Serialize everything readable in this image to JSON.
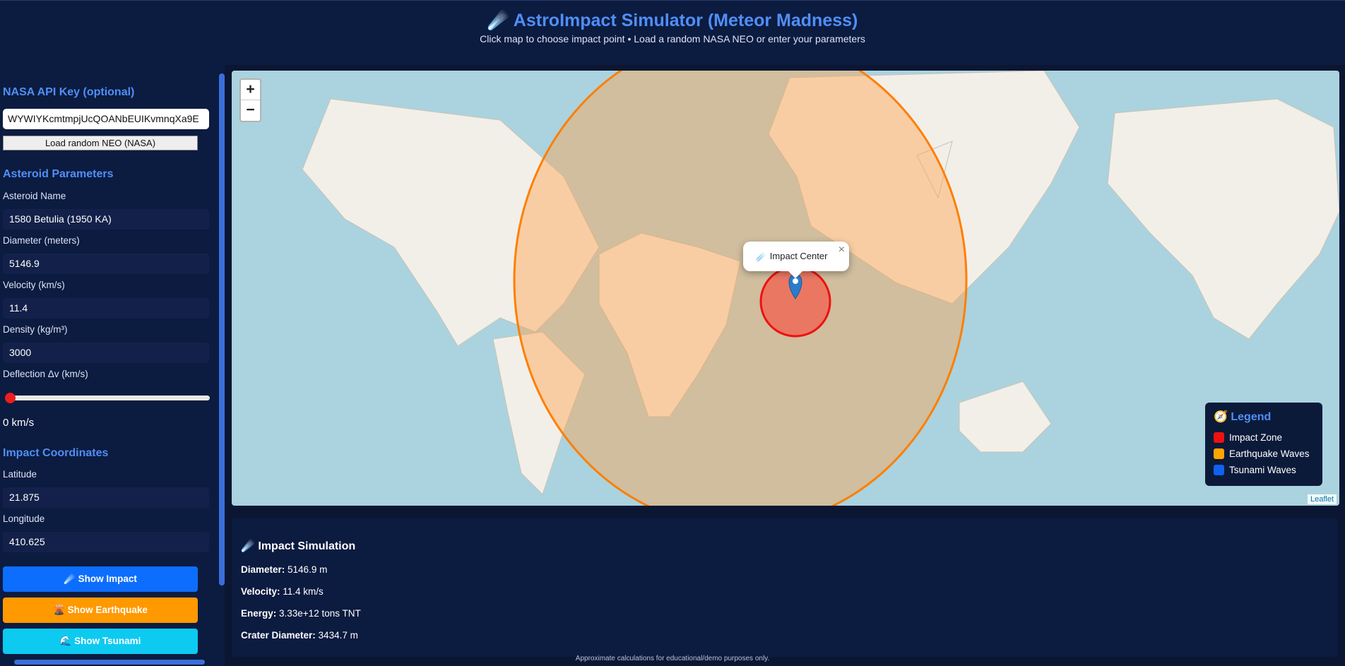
{
  "header": {
    "icon": "☄️",
    "title": "AstroImpact Simulator (Meteor Madness)",
    "subtitle": "Click map to choose impact point • Load a random NASA NEO or enter your parameters"
  },
  "sidebar": {
    "api_heading": "NASA API Key (optional)",
    "api_value": "WYWIYKcmtmpjUcQOANbEUIKvmnqXa9E",
    "load_neo_label": "Load random NEO (NASA)",
    "params_heading": "Asteroid Parameters",
    "name_label": "Asteroid Name",
    "name_value": "1580 Betulia (1950 KA)",
    "diameter_label": "Diameter (meters)",
    "diameter_value": "5146.9",
    "velocity_label": "Velocity (km/s)",
    "velocity_value": "11.4",
    "density_label": "Density (kg/m³)",
    "density_value": "3000",
    "deflection_label": "Deflection Δv (km/s)",
    "deflection_value": 0,
    "deflection_text": "0 km/s",
    "coords_heading": "Impact Coordinates",
    "lat_label": "Latitude",
    "lat_value": "21.875",
    "lon_label": "Longitude",
    "lon_value": "410.625",
    "btn_impact": "☄️ Show Impact",
    "btn_earthquake": "🌋 Show Earthquake",
    "btn_tsunami": "🌊 Show Tsunami"
  },
  "map": {
    "zoom_in": "+",
    "zoom_out": "−",
    "popup_text": "☄️ Impact Center",
    "popup_close": "×",
    "attribution": "Leaflet",
    "legend": {
      "title": "🧭 Legend",
      "items": [
        {
          "label": "Impact Zone",
          "color": "#ee1111"
        },
        {
          "label": "Earthquake Waves",
          "color": "#ffa500"
        },
        {
          "label": "Tsunami Waves",
          "color": "#1160ee"
        }
      ]
    }
  },
  "results": {
    "title": "☄️ Impact Simulation",
    "diameter_label": "Diameter:",
    "diameter_value": " 5146.9 m",
    "velocity_label": "Velocity:",
    "velocity_value": " 11.4 km/s",
    "energy_label": "Energy:",
    "energy_value": " 3.33e+12 tons TNT",
    "crater_label": "Crater Diameter:",
    "crater_value": " 3434.7 m"
  },
  "footer": "Approximate calculations for educational/demo purposes only.",
  "colors": {
    "accent": "#4f8ff7",
    "impact_btn": "#0d6efd",
    "earthquake_btn": "#ff9900",
    "tsunami_btn": "#0dcaf0"
  }
}
